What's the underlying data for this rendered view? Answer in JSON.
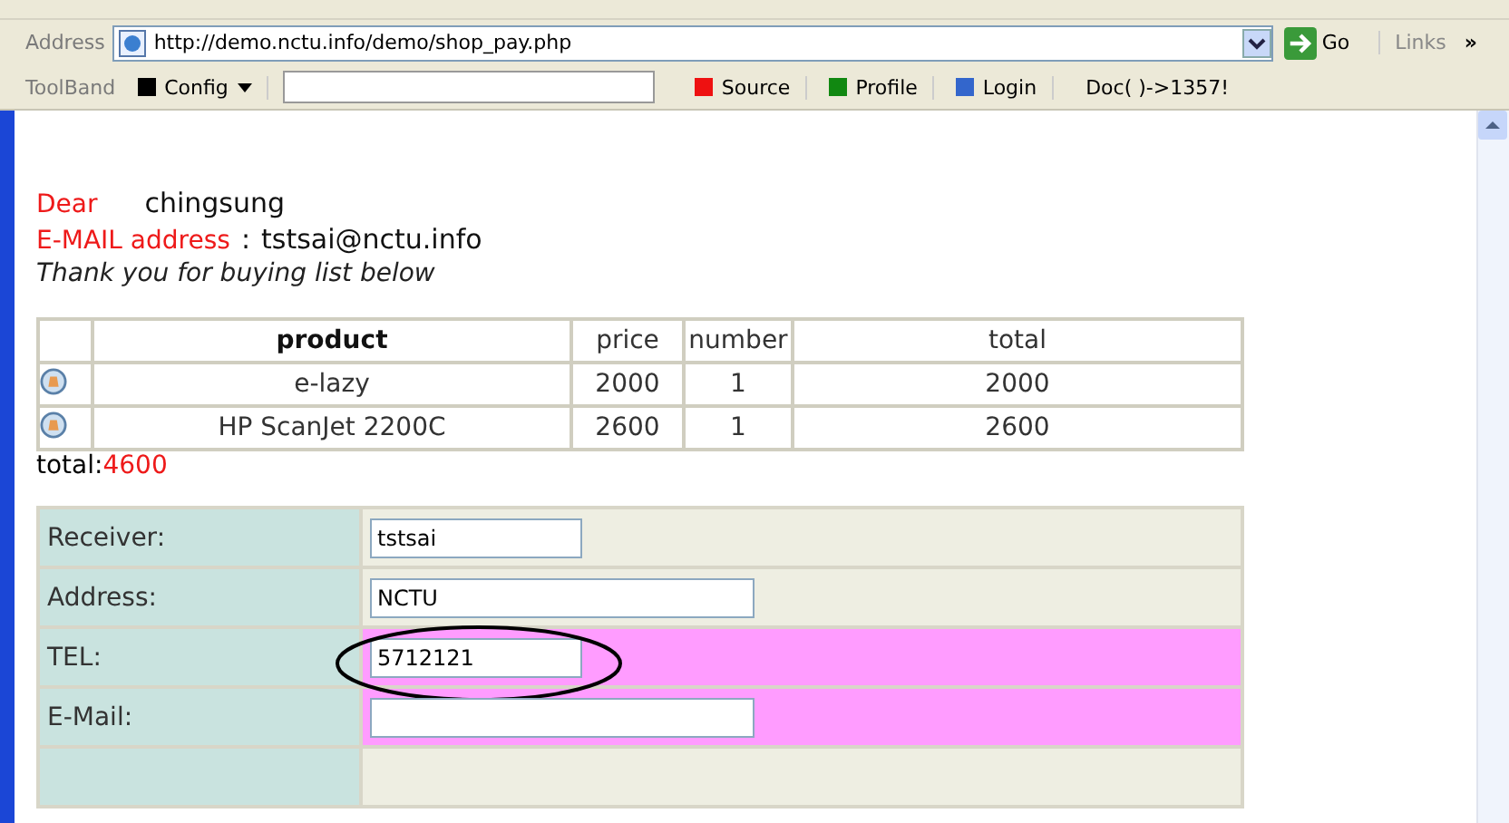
{
  "address_bar": {
    "label": "Address",
    "url": "http://demo.nctu.info/demo/shop_pay.php",
    "go": "Go",
    "links": "Links",
    "more": "»"
  },
  "toolband": {
    "label": "ToolBand",
    "config": "Config",
    "buttons": [
      {
        "label": "Source",
        "color": "#ee1111"
      },
      {
        "label": "Profile",
        "color": "#118811"
      },
      {
        "label": "Login",
        "color": "#3366cc"
      }
    ],
    "doc": "Doc( )->1357!"
  },
  "greeting": {
    "dear_label": "Dear",
    "name": "chingsung",
    "email_label": "E-MAIL address",
    "email_sep": ":",
    "email": "tstsai@nctu.info",
    "thanks": "Thank you for buying list below"
  },
  "order_table": {
    "columns": [
      "product",
      "price",
      "number",
      "total"
    ],
    "rows": [
      {
        "product": "e-lazy",
        "price": "2000",
        "number": "1",
        "total": "2000"
      },
      {
        "product": "HP ScanJet 2200C",
        "price": "2600",
        "number": "1",
        "total": "2600"
      }
    ]
  },
  "total": {
    "label": "total:",
    "value": "4600"
  },
  "form": [
    {
      "label": "Receiver:",
      "value": "tstsai",
      "kind": "short",
      "highlighted": false,
      "circled": false
    },
    {
      "label": "Address:",
      "value": "NCTU",
      "kind": "long",
      "highlighted": false,
      "circled": false
    },
    {
      "label": "TEL:",
      "value": "5712121",
      "kind": "short",
      "highlighted": true,
      "circled": true
    },
    {
      "label": "E-Mail:",
      "kind": "long",
      "highlighted": true,
      "circled": false
    }
  ]
}
